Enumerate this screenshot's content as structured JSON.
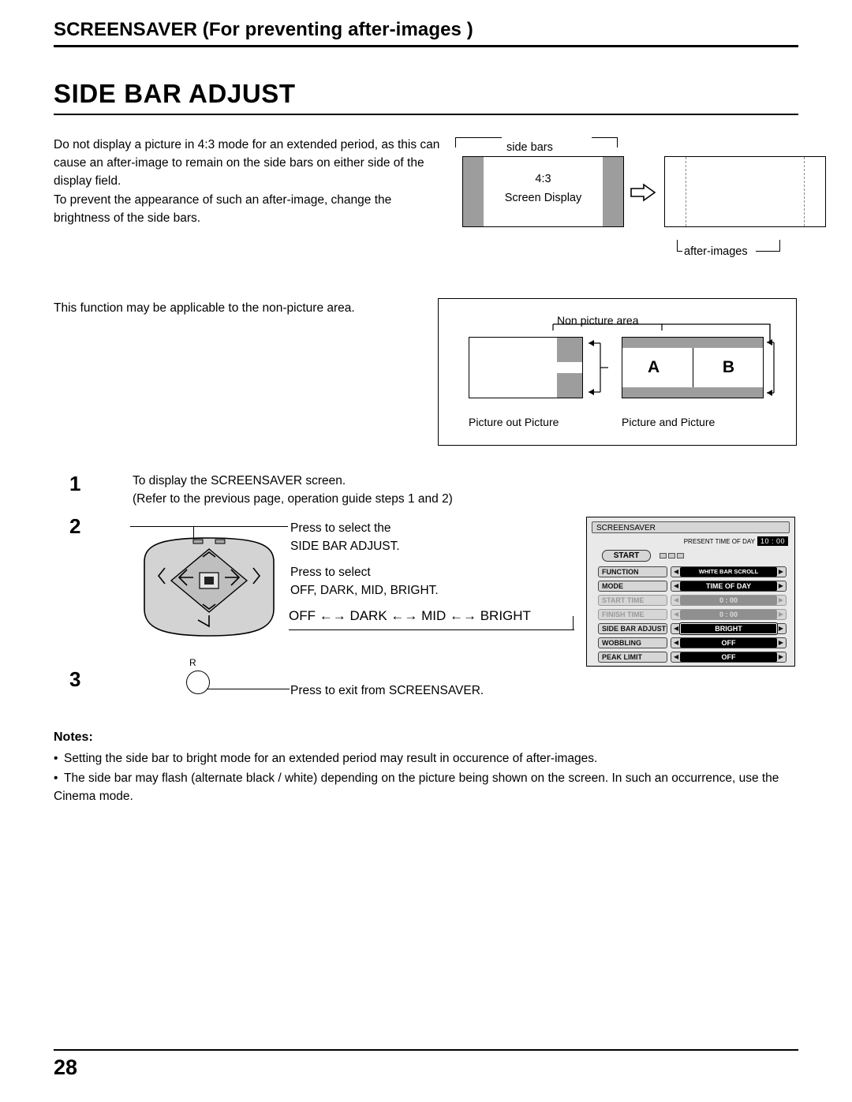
{
  "header": {
    "title": "SCREENSAVER (For preventing after-images )"
  },
  "main_title": "SIDE BAR ADJUST",
  "paragraphs": {
    "p1": "Do not display a picture in 4:3 mode for an extended period, as this can cause an after-image to remain on the side bars on either side of the display field.",
    "p2": "To prevent the appearance of such an after-image, change the brightness of the side bars.",
    "p3": "This function may be applicable to the non-picture area."
  },
  "figure1": {
    "sidebars_label": "side bars",
    "screen_line1": "4:3",
    "screen_line2": "Screen Display",
    "after_images_label": "after-images",
    "arrow_icon": "right-arrow-icon"
  },
  "figure2": {
    "non_picture_area_label": "Non picture area",
    "picture_out_picture_label": "Picture out Picture",
    "picture_and_picture_label": "Picture and Picture",
    "letter_a": "A",
    "letter_b": "B"
  },
  "steps": {
    "s1_num": "1",
    "s1_line1": "To display the SCREENSAVER screen.",
    "s1_line2": "(Refer to the previous page, operation guide steps 1 and 2)",
    "s2_num": "2",
    "s2_line1": "Press to select the",
    "s2_line2": "SIDE BAR ADJUST.",
    "s2_line3": "Press to select",
    "s2_line4": "OFF, DARK, MID, BRIGHT.",
    "chain": "OFF ←→ DARK ←→ MID ←→ BRIGHT",
    "chain_items": [
      "OFF",
      "DARK",
      "MID",
      "BRIGHT"
    ],
    "s3_num": "3",
    "s3_line1": "Press to exit from SCREENSAVER.",
    "remote_button_label": "R"
  },
  "osd": {
    "title": "SCREENSAVER",
    "present_time_label": "PRESENT TIME OF DAY",
    "present_time_value": "10 : 00",
    "start_button": "START",
    "rows": [
      {
        "label": "FUNCTION",
        "value": "WHITE BAR SCROLL",
        "dim": false,
        "highlight": false
      },
      {
        "label": "MODE",
        "value": "TIME OF DAY",
        "dim": false,
        "highlight": false
      },
      {
        "label": "START TIME",
        "value": "0 : 00",
        "dim": true,
        "highlight": false
      },
      {
        "label": "FINISH TIME",
        "value": "0 : 00",
        "dim": true,
        "highlight": false
      },
      {
        "label": "SIDE BAR ADJUST",
        "value": "BRIGHT",
        "dim": false,
        "highlight": true
      },
      {
        "label": "WOBBLING",
        "value": "OFF",
        "dim": false,
        "highlight": false
      },
      {
        "label": "PEAK LIMIT",
        "value": "OFF",
        "dim": false,
        "highlight": false
      }
    ]
  },
  "notes": {
    "title": "Notes:",
    "n1": "Setting the side bar to bright mode for an extended period may result in occurence of after-images.",
    "n2": "The side bar may flash (alternate black / white) depending on the picture being shown on the screen. In such an occurrence, use the Cinema mode."
  },
  "footer": {
    "page_number": "28"
  }
}
